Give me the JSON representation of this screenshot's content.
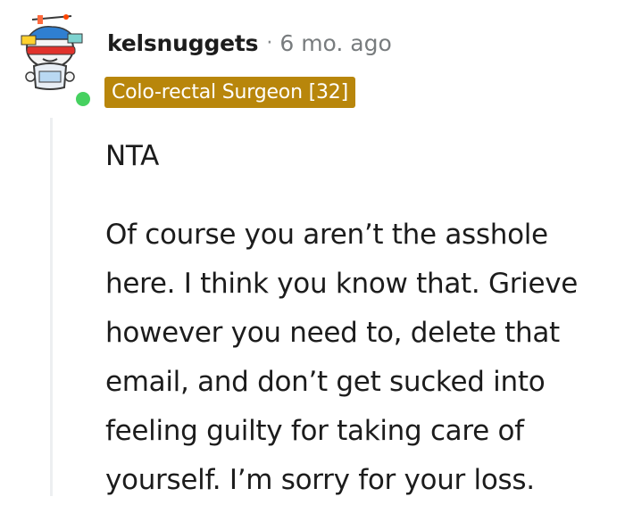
{
  "comment": {
    "username": "kelsnuggets",
    "separator": "·",
    "timestamp": "6 mo. ago",
    "flair": "Colo-rectal Surgeon [32]",
    "online": true,
    "avatar_icon": "snoo-avatar-icon",
    "paragraphs": [
      "NTA",
      "Of course you aren’t the asshole here. I think you know that. Grieve however you need to, delete that email, and don’t get sucked into feeling guilty for taking care of yourself. I’m sorry for your loss."
    ]
  },
  "colors": {
    "flair_bg": "#b8860b",
    "online": "#46d160",
    "thread_line": "#edeff1"
  }
}
